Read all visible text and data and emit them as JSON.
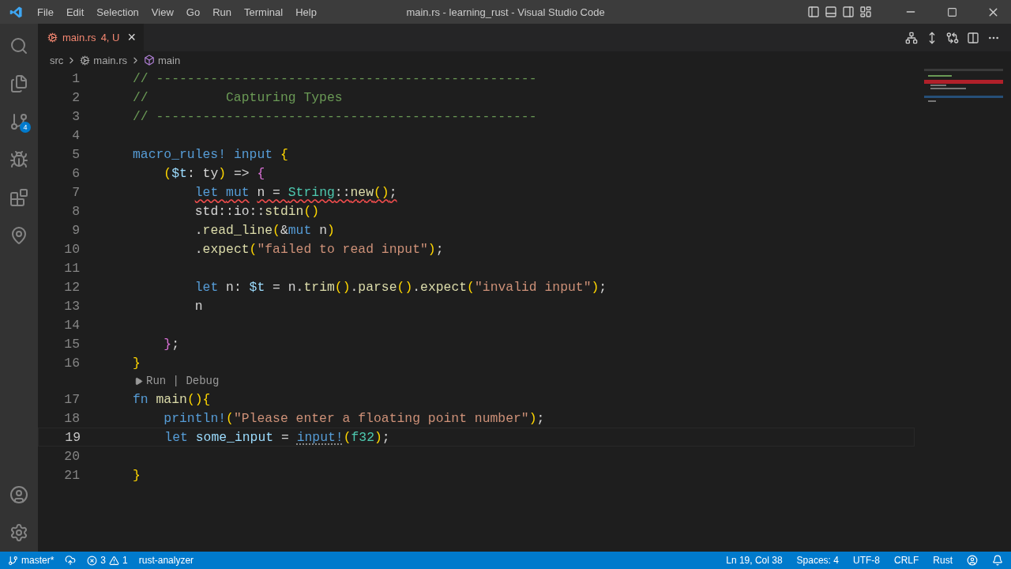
{
  "window": {
    "title": "main.rs - learning_rust - Visual Studio Code"
  },
  "menu": [
    "File",
    "Edit",
    "Selection",
    "View",
    "Go",
    "Run",
    "Terminal",
    "Help"
  ],
  "activity_bar": {
    "source_control_badge": "4"
  },
  "tabs": [
    {
      "label": "main.rs",
      "status": "4, U",
      "selected": true,
      "has_errors": true,
      "close": "×"
    }
  ],
  "breadcrumbs": [
    {
      "kind": "folder",
      "label": "src"
    },
    {
      "kind": "file",
      "label": "main.rs"
    },
    {
      "kind": "symbol",
      "label": "main"
    }
  ],
  "editor": {
    "lines": [
      {
        "kind": "code",
        "number": "1",
        "tokens": [
          {
            "kind": "comment",
            "text": "// -------------------------------------------------"
          }
        ]
      },
      {
        "kind": "code",
        "number": "2",
        "tokens": [
          {
            "kind": "comment",
            "text": "//          Capturing Types"
          }
        ]
      },
      {
        "kind": "code",
        "number": "3",
        "tokens": [
          {
            "kind": "comment",
            "text": "// -------------------------------------------------"
          }
        ]
      },
      {
        "kind": "code",
        "number": "4"
      },
      {
        "kind": "code",
        "number": "5",
        "tokens": [
          {
            "kind": "keyword",
            "text": "macro_rules! "
          },
          {
            "kind": "keyword",
            "text": "input "
          },
          {
            "kind": "brace",
            "text": "{"
          }
        ]
      },
      {
        "kind": "code",
        "number": "6",
        "tokens": [
          {
            "kind": "paren",
            "text": "    ("
          },
          {
            "kind": "variable",
            "text": "$t"
          },
          {
            "kind": "plain",
            "text": ": ty"
          },
          {
            "kind": "paren",
            "text": ")"
          },
          {
            "kind": "plain",
            "text": " => "
          },
          {
            "kind": "brace2",
            "text": "{"
          }
        ]
      },
      {
        "kind": "code",
        "number": "7",
        "tokens": [
          {
            "kind": "keyword",
            "text": "        let ",
            "err": true
          },
          {
            "kind": "keyword",
            "text": "mut",
            "err": true
          },
          {
            "kind": "plain",
            "text": " n = ",
            "err": true
          },
          {
            "kind": "type",
            "text": "String",
            "err": true
          },
          {
            "kind": "plain",
            "text": "::",
            "err": true
          },
          {
            "kind": "function",
            "text": "new",
            "err": true
          },
          {
            "kind": "paren",
            "text": "()",
            "err": true
          },
          {
            "kind": "plain",
            "text": ";",
            "err": true
          }
        ]
      },
      {
        "kind": "code",
        "number": "8",
        "tokens": [
          {
            "kind": "plain",
            "text": "        std::io::"
          },
          {
            "kind": "function",
            "text": "stdin"
          },
          {
            "kind": "paren",
            "text": "()"
          }
        ]
      },
      {
        "kind": "code",
        "number": "9",
        "tokens": [
          {
            "kind": "plain",
            "text": "        ."
          },
          {
            "kind": "function",
            "text": "read_line"
          },
          {
            "kind": "paren",
            "text": "("
          },
          {
            "kind": "plain",
            "text": "&"
          },
          {
            "kind": "keyword",
            "text": "mut"
          },
          {
            "kind": "plain",
            "text": " n"
          },
          {
            "kind": "paren",
            "text": ")"
          }
        ]
      },
      {
        "kind": "code",
        "number": "10",
        "tokens": [
          {
            "kind": "plain",
            "text": "        ."
          },
          {
            "kind": "function",
            "text": "expect"
          },
          {
            "kind": "paren",
            "text": "("
          },
          {
            "kind": "string",
            "text": "\"failed to read input\""
          },
          {
            "kind": "paren",
            "text": ")"
          },
          {
            "kind": "plain",
            "text": ";"
          }
        ]
      },
      {
        "kind": "code",
        "number": "11"
      },
      {
        "kind": "code",
        "number": "12",
        "tokens": [
          {
            "kind": "keyword",
            "text": "        let"
          },
          {
            "kind": "plain",
            "text": " n: "
          },
          {
            "kind": "variable",
            "text": "$t"
          },
          {
            "kind": "plain",
            "text": " = n."
          },
          {
            "kind": "function",
            "text": "trim"
          },
          {
            "kind": "paren",
            "text": "()"
          },
          {
            "kind": "plain",
            "text": "."
          },
          {
            "kind": "function",
            "text": "parse"
          },
          {
            "kind": "paren",
            "text": "()"
          },
          {
            "kind": "plain",
            "text": "."
          },
          {
            "kind": "function",
            "text": "expect"
          },
          {
            "kind": "paren",
            "text": "("
          },
          {
            "kind": "string",
            "text": "\"invalid input\""
          },
          {
            "kind": "paren",
            "text": ")"
          },
          {
            "kind": "plain",
            "text": ";"
          }
        ]
      },
      {
        "kind": "code",
        "number": "13",
        "tokens": [
          {
            "kind": "plain",
            "text": "        n"
          }
        ]
      },
      {
        "kind": "code",
        "number": "14"
      },
      {
        "kind": "code",
        "number": "15",
        "tokens": [
          {
            "kind": "brace2",
            "text": "    }"
          },
          {
            "kind": "plain",
            "text": ";"
          }
        ]
      },
      {
        "kind": "code",
        "number": "16",
        "tokens": [
          {
            "kind": "brace",
            "text": "}"
          }
        ]
      },
      {
        "kind": "codelens",
        "text": "Run | Debug"
      },
      {
        "kind": "code",
        "number": "17",
        "tokens": [
          {
            "kind": "keyword",
            "text": "fn "
          },
          {
            "kind": "function",
            "text": "main"
          },
          {
            "kind": "paren",
            "text": "()"
          },
          {
            "kind": "brace",
            "text": "{"
          }
        ]
      },
      {
        "kind": "code",
        "number": "18",
        "tokens": [
          {
            "kind": "keyword",
            "text": "    println!"
          },
          {
            "kind": "paren",
            "text": "("
          },
          {
            "kind": "string",
            "text": "\"Please enter a floating point number\""
          },
          {
            "kind": "paren",
            "text": ")"
          },
          {
            "kind": "plain",
            "text": ";"
          }
        ]
      },
      {
        "kind": "code",
        "number": "19",
        "current": true,
        "tokens": [
          {
            "kind": "keyword",
            "text": "    let "
          },
          {
            "kind": "variable",
            "text": "some_input"
          },
          {
            "kind": "plain",
            "text": " = "
          },
          {
            "kind": "keyword",
            "text": "input!",
            "hint": true
          },
          {
            "kind": "paren",
            "text": "("
          },
          {
            "kind": "type",
            "text": "f32"
          },
          {
            "kind": "paren",
            "text": ")"
          },
          {
            "kind": "plain",
            "text": ";"
          }
        ]
      },
      {
        "kind": "code",
        "number": "20"
      },
      {
        "kind": "code",
        "number": "21",
        "tokens": [
          {
            "kind": "brace",
            "text": "}"
          }
        ]
      }
    ]
  },
  "status_bar": {
    "branch": "master*",
    "errors": "3",
    "warnings": "1",
    "server": "rust-analyzer",
    "right": [
      "Ln 19, Col 38",
      "Spaces: 4",
      "UTF-8",
      "CRLF",
      "Rust"
    ]
  }
}
